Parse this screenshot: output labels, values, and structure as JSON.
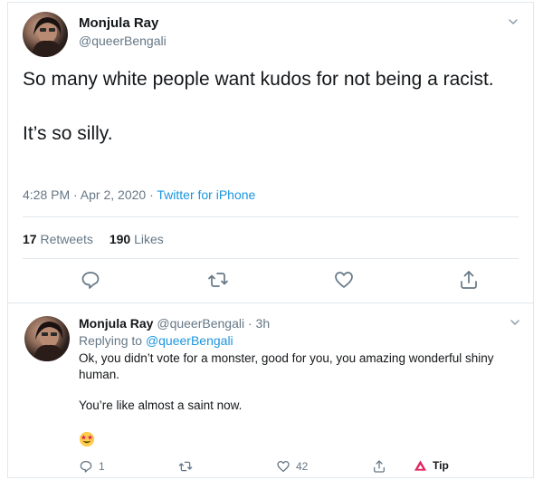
{
  "main_tweet": {
    "author_name": "Monjula Ray",
    "author_handle": "@queerBengali",
    "paragraphs": [
      "So many white people want kudos for not being a racist.",
      "It’s so silly."
    ],
    "time": "4:28 PM · Apr 2, 2020 · ",
    "source": "Twitter for iPhone",
    "retweets_count": "17",
    "retweets_label": "Retweets",
    "likes_count": "190",
    "likes_label": "Likes"
  },
  "reply": {
    "author_name": "Monjula Ray",
    "author_handle": "@queerBengali",
    "time": " · 3h",
    "replying_label": "Replying to ",
    "replying_to": "@queerBengali",
    "paragraphs": [
      "Ok, you didn’t vote for a monster, good for you, you amazing wonderful shiny human.",
      "You’re like almost a saint now."
    ],
    "reply_count": "1",
    "like_count": "42",
    "tip_label": "Tip"
  },
  "colors": {
    "link": "#1b95e0",
    "muted": "#657786",
    "border": "#e1e8ed",
    "tip_icon": "#e0245e"
  },
  "icons": [
    "chevron-down-icon",
    "reply-icon",
    "retweet-icon",
    "like-icon",
    "share-icon",
    "star-struck-emoji",
    "tip-icon"
  ]
}
